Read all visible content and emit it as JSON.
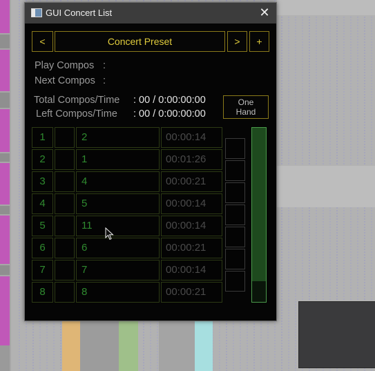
{
  "window": {
    "title": "GUI Concert List",
    "close_glyph": "✕"
  },
  "preset": {
    "prev_label": "<",
    "name": "Concert Preset",
    "next_label": ">",
    "add_label": "+"
  },
  "status": {
    "play_label": "Play Compos",
    "play_sep": ":",
    "next_label": "Next Compos",
    "next_sep": ":",
    "total_label": "Total Compos/Time",
    "total_value": ": 00 / 0:00:00:00",
    "left_label": "Left Compos/Time",
    "left_value": ": 00 / 0:00:00:00"
  },
  "one_hand": {
    "line1": "One",
    "line2": "Hand"
  },
  "list": {
    "rows": [
      {
        "num": "1",
        "compos": "2",
        "time": "00:00:14"
      },
      {
        "num": "2",
        "compos": "1",
        "time": "00:01:26"
      },
      {
        "num": "3",
        "compos": "4",
        "time": "00:00:21"
      },
      {
        "num": "4",
        "compos": "5",
        "time": "00:00:14"
      },
      {
        "num": "5",
        "compos": "11",
        "time": "00:00:14"
      },
      {
        "num": "6",
        "compos": "6",
        "time": "00:00:21"
      },
      {
        "num": "7",
        "compos": "7",
        "time": "00:00:14"
      },
      {
        "num": "8",
        "compos": "8",
        "time": "00:00:21"
      }
    ]
  },
  "scrollbar": {
    "thumb_fraction": 0.88
  },
  "colors": {
    "accent_gold": "#e0cc3c",
    "list_green": "#2f8a2f",
    "scroll_green": "#4a9a4a"
  },
  "icons": {
    "app": "window-icon",
    "close": "close-icon",
    "cursor": "mouse-pointer-icon"
  }
}
